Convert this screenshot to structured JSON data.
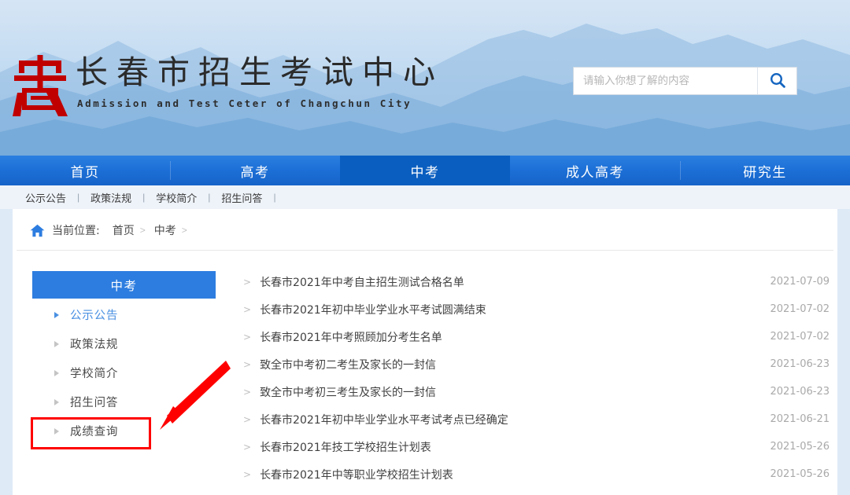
{
  "header": {
    "site_title": "长春市招生考试中心",
    "site_subtitle": "Admission and Test Ceter of Changchun City",
    "logo_alt": "seal-logo",
    "search": {
      "placeholder": "请输入你想了解的内容",
      "value": "",
      "button_icon": "search-icon"
    }
  },
  "nav": {
    "items": [
      {
        "label": "首页",
        "active": false
      },
      {
        "label": "高考",
        "active": false
      },
      {
        "label": "中考",
        "active": true
      },
      {
        "label": "成人高考",
        "active": false
      },
      {
        "label": "研究生",
        "active": false
      }
    ]
  },
  "subnav": {
    "separator": "|",
    "items": [
      {
        "label": "公示公告"
      },
      {
        "label": "政策法规"
      },
      {
        "label": "学校简介"
      },
      {
        "label": "招生问答"
      }
    ]
  },
  "breadcrumb": {
    "home_icon": "home-icon",
    "label": "当前位置:",
    "arrow": ">",
    "links": [
      {
        "label": "首页"
      },
      {
        "label": "中考"
      }
    ]
  },
  "sidebar": {
    "title": "中考",
    "items": [
      {
        "label": "公示公告",
        "active": true,
        "highlighted": false
      },
      {
        "label": "政策法规",
        "active": false,
        "highlighted": false
      },
      {
        "label": "学校简介",
        "active": false,
        "highlighted": false
      },
      {
        "label": "招生问答",
        "active": false,
        "highlighted": false
      },
      {
        "label": "成绩查询",
        "active": false,
        "highlighted": true
      }
    ]
  },
  "annotation": {
    "color": "#ff0000",
    "arrow": "red-arrow-pointing-to-score-query",
    "box_target": "成绩查询"
  },
  "list": {
    "bullet": ">",
    "items": [
      {
        "title": "长春市2021年中考自主招生测试合格名单",
        "date": "2021-07-09"
      },
      {
        "title": "长春市2021年初中毕业学业水平考试圆满结束",
        "date": "2021-07-02"
      },
      {
        "title": "长春市2021年中考照顾加分考生名单",
        "date": "2021-07-02"
      },
      {
        "title": "致全市中考初二考生及家长的一封信",
        "date": "2021-06-23"
      },
      {
        "title": "致全市中考初三考生及家长的一封信",
        "date": "2021-06-23"
      },
      {
        "title": "长春市2021年初中毕业学业水平考试考点已经确定",
        "date": "2021-06-21"
      },
      {
        "title": "长春市2021年技工学校招生计划表",
        "date": "2021-05-26"
      },
      {
        "title": "长春市2021年中等职业学校招生计划表",
        "date": "2021-05-26"
      }
    ]
  },
  "colors": {
    "nav_blue": "#1c6fd6",
    "nav_active_blue": "#0a5ec0",
    "sidebar_head_blue": "#2d7de0",
    "accent_blue": "#4a90e2",
    "logo_red": "#c00000",
    "annotation_red": "#ff0000"
  }
}
